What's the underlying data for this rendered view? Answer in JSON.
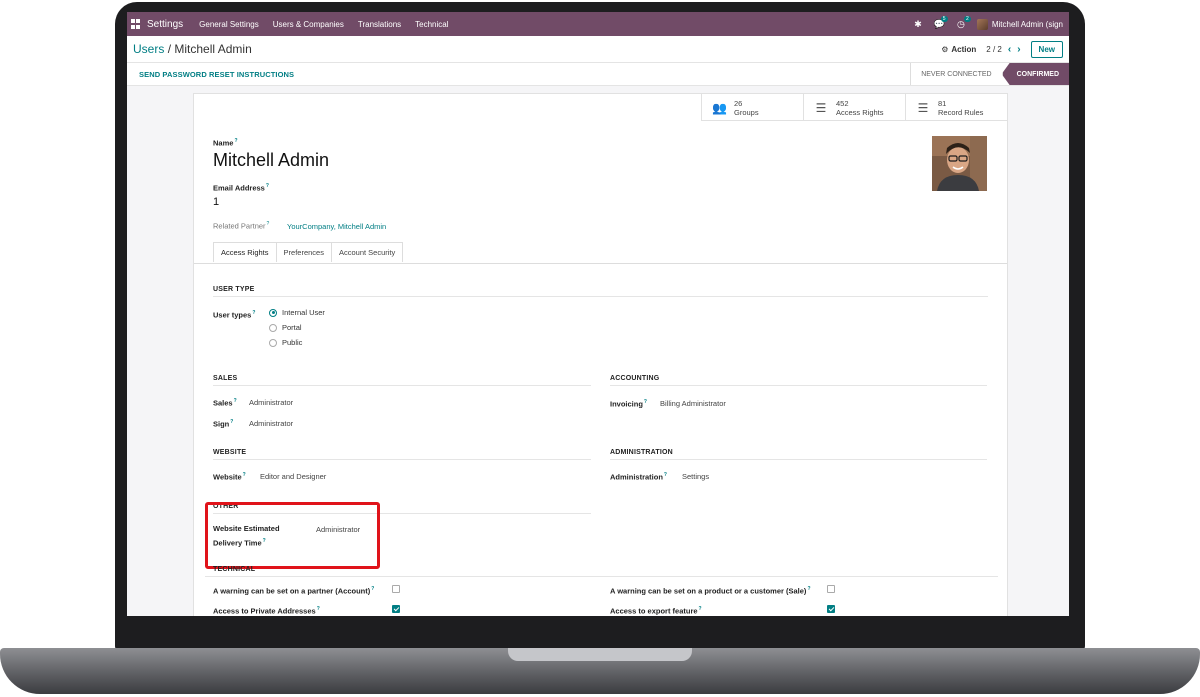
{
  "navbar": {
    "app_name": "Settings",
    "menu": [
      "General Settings",
      "Users & Companies",
      "Translations",
      "Technical"
    ],
    "messages_count": "5",
    "activities_count": "2",
    "user_name": "Mitchell Admin (sign"
  },
  "control": {
    "breadcrumb_parent": "Users",
    "breadcrumb_sep": "/",
    "breadcrumb_current": "Mitchell Admin",
    "action_label": "Action",
    "pager_value": "2 / 2",
    "new_label": "New"
  },
  "statusbar": {
    "reset_label": "SEND PASSWORD RESET INSTRUCTIONS",
    "steps": [
      "NEVER CONNECTED",
      "CONFIRMED"
    ]
  },
  "stat_buttons": [
    {
      "count": "26",
      "label": "Groups",
      "icon": "users-icon"
    },
    {
      "count": "452",
      "label": "Access Rights",
      "icon": "list-icon"
    },
    {
      "count": "81",
      "label": "Record Rules",
      "icon": "list-icon"
    }
  ],
  "form": {
    "name_label": "Name",
    "name_value": "Mitchell Admin",
    "email_label": "Email Address",
    "email_value": "1",
    "partner_label": "Related Partner",
    "partner_value": "YourCompany, Mitchell Admin",
    "help_mark": "?"
  },
  "tabs": [
    "Access Rights",
    "Preferences",
    "Account Security"
  ],
  "access": {
    "user_type_title": "USER TYPE",
    "user_types_label": "User types",
    "user_type_options": [
      "Internal User",
      "Portal",
      "Public"
    ],
    "user_type_selected": "Internal User",
    "sales_title": "SALES",
    "sales_label": "Sales",
    "sales_value": "Administrator",
    "sign_label": "Sign",
    "sign_value": "Administrator",
    "accounting_title": "ACCOUNTING",
    "invoicing_label": "Invoicing",
    "invoicing_value": "Billing Administrator",
    "website_title": "WEBSITE",
    "website_label": "Website",
    "website_value": "Editor and Designer",
    "administration_title": "ADMINISTRATION",
    "administration_label": "Administration",
    "administration_value": "Settings",
    "other_title": "OTHER",
    "delivery_label_line1": "Website Estimated",
    "delivery_label_line2": "Delivery Time",
    "delivery_value": "Administrator",
    "technical_title": "TECHNICAL",
    "tech_partner_warning": "A warning can be set on a partner (Account)",
    "tech_partner_warning_checked": false,
    "tech_product_warning": "A warning can be set on a product or a customer (Sale)",
    "tech_product_warning_checked": false,
    "tech_private_addresses": "Access to Private Addresses",
    "tech_private_addresses_checked": true,
    "tech_export": "Access to export feature",
    "tech_export_checked": true
  },
  "colors": {
    "brand": "#714b67",
    "accent": "#017e84",
    "highlight": "#e0131a"
  }
}
